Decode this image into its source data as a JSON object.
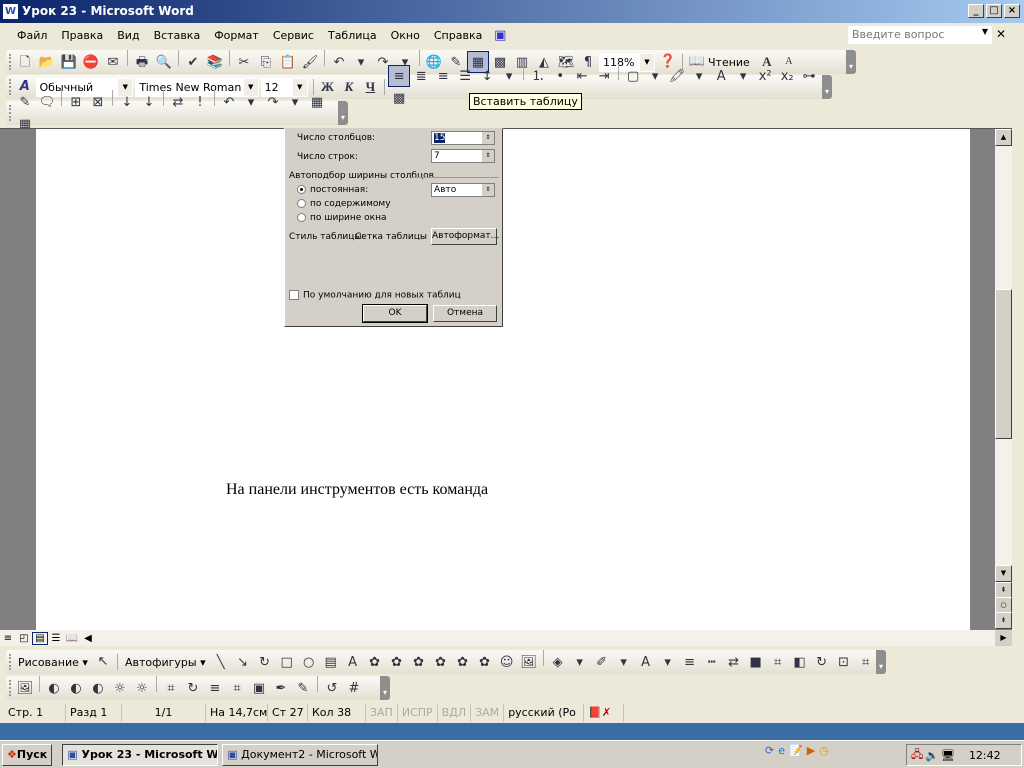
{
  "window": {
    "title": "Урок 23 - Microsoft Word",
    "controls": [
      "_",
      "□",
      "×"
    ]
  },
  "menu": {
    "items": [
      "Файл",
      "Правка",
      "Вид",
      "Вставка",
      "Формат",
      "Сервис",
      "Таблица",
      "Окно",
      "Справка"
    ],
    "help_placeholder": "Введите вопрос"
  },
  "toolbar_standard": {
    "icons": [
      "new-icon",
      "open-icon",
      "save-icon",
      "permission-icon",
      "email-icon",
      "|",
      "print-icon",
      "print-preview-icon",
      "|",
      "spelling-icon",
      "research-icon",
      "|",
      "cut-icon",
      "copy-icon",
      "paste-icon",
      "format-painter-icon",
      "|",
      "undo-icon",
      "dropdown-icon",
      "redo-icon",
      "dropdown-icon",
      "|",
      "hyperlink-icon",
      "tables-borders-icon",
      "insert-table-icon",
      "insert-excel-icon",
      "columns-icon",
      "drawing-icon",
      "document-map-icon",
      "show-hide-icon"
    ],
    "zoom": "118%",
    "reading_label": "Чтение"
  },
  "toolbar_formatting": {
    "style": "Обычный",
    "font": "Times New Roman",
    "size": "12",
    "bold": "Ж",
    "italic": "К",
    "underline": "Ч"
  },
  "tooltip": "Вставить таблицу",
  "dialog": {
    "columns_label": "Число столбцов:",
    "columns_value": "15",
    "rows_label": "Число строк:",
    "rows_value": "7",
    "autofit_group": "Автоподбор ширины столбцов",
    "fixed_label": "постоянная:",
    "fixed_value": "Авто",
    "content_label": "по содержимому",
    "window_label": "по ширине окна",
    "style_label": "Стиль таблицы:",
    "style_value": "Сетка таблицы",
    "autoformat_button": "Автоформат...",
    "default_checkbox": "По умолчанию для новых таблиц",
    "ok_button": "OK",
    "cancel_button": "Отмена",
    "selected_autofit": "fixed"
  },
  "document": {
    "text": "На панели инструментов есть команда"
  },
  "drawing_toolbar": {
    "draw_label": "Рисование",
    "autoshapes_label": "Автофигуры"
  },
  "status": {
    "page": "Стр. 1",
    "section": "Разд 1",
    "pages": "1/1",
    "at": "На 14,7см",
    "line": "Ст 27",
    "col": "Кол 38",
    "rec": "ЗАП",
    "trk": "ИСПР",
    "ext": "ВДЛ",
    "ovr": "ЗАМ",
    "lang": "русский (Ро"
  },
  "taskbar": {
    "start": "Пуск",
    "tasks": [
      "Урок 23 - Microsoft W...",
      "Документ2 - Microsoft W..."
    ],
    "clock": "12:42"
  }
}
